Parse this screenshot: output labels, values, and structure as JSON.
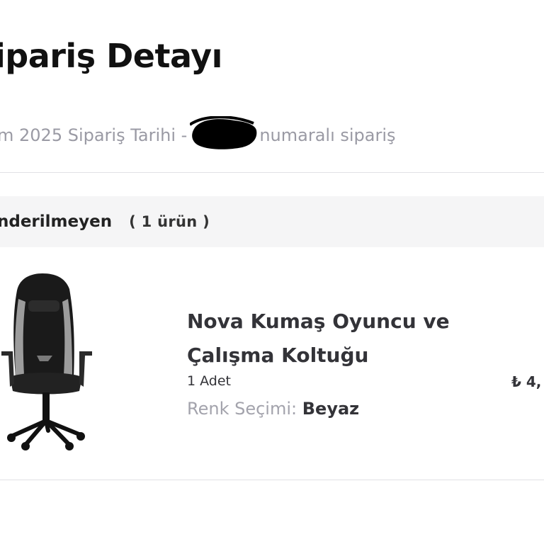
{
  "header": {
    "title": "ipariş Detayı",
    "order_date_text": "m 2025 Sipariş Tarihi -",
    "order_number_suffix": "numaralı sipariş"
  },
  "shipment_group": {
    "title": "nderilmeyen",
    "count": "( 1 ürün )"
  },
  "item": {
    "name": "Nova Kumaş Oyuncu ve Çalışma Koltuğu",
    "quantity": "1 Adet",
    "price": "₺ 4,",
    "option_label": "Renk Seçimi:",
    "option_value": "Beyaz",
    "image_icon": "gaming-chair-image"
  },
  "colors": {
    "background": "#ffffff",
    "title_text": "#111111",
    "muted_text": "#9a9aa4",
    "header_band": "#f5f5f6",
    "divider": "#e1e1e5"
  }
}
